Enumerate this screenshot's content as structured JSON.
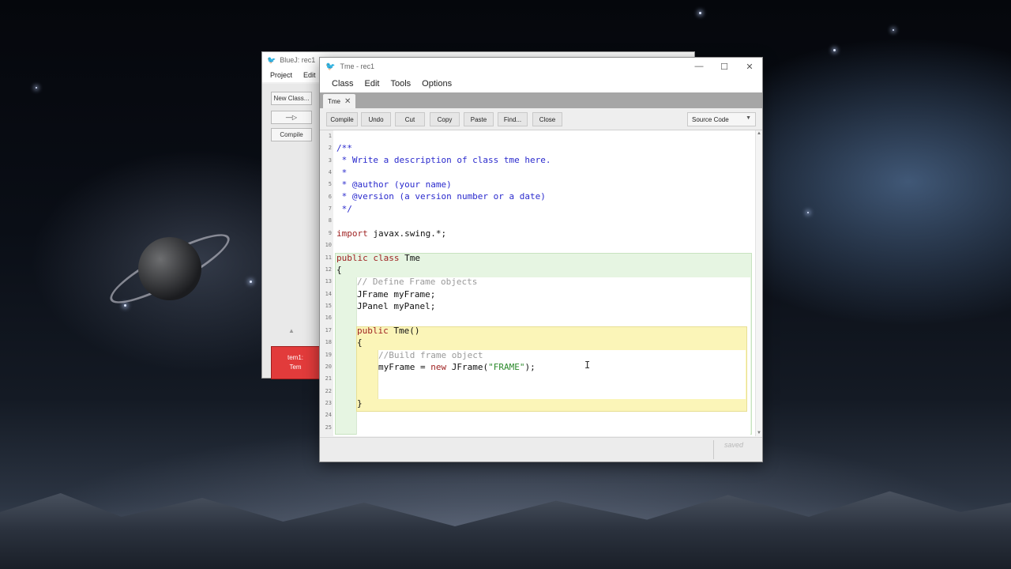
{
  "bluej_window": {
    "title": "BlueJ: rec1",
    "menu": [
      "Project",
      "Edit"
    ],
    "buttons": {
      "new_class": "New Class...",
      "arrow": "—▷",
      "compile": "Compile"
    },
    "class_box": {
      "line1": "tem1:",
      "line2": "Tem"
    }
  },
  "editor": {
    "title": "Tme - rec1",
    "window_controls": {
      "minimize": "—",
      "maximize": "☐",
      "close": "✕"
    },
    "menu": [
      "Class",
      "Edit",
      "Tools",
      "Options"
    ],
    "tab": {
      "label": "Tme",
      "close": "✕"
    },
    "toolbar": [
      "Compile",
      "Undo",
      "Cut",
      "Copy",
      "Paste",
      "Find...",
      "Close"
    ],
    "view_select": "Source Code",
    "line_numbers": [
      "1",
      "2",
      "3",
      "4",
      "5",
      "6",
      "7",
      "8",
      "9",
      "10",
      "11",
      "12",
      "13",
      "14",
      "15",
      "16",
      "17",
      "18",
      "19",
      "20",
      "21",
      "22",
      "23",
      "24",
      "25"
    ],
    "code": {
      "l2": "/**",
      "l3": " * Write a description of class tme here.",
      "l4": " *",
      "l5": " * @author (your name)",
      "l6": " * @version (a version number or a date)",
      "l7": " */",
      "l9_kw": "import",
      "l9_rest": " javax.swing.*;",
      "l11_kw1": "public",
      "l11_kw2": "class",
      "l11_rest": " Tme",
      "l12": "{",
      "l13": "// Define Frame objects",
      "l14": "JFrame myFrame;",
      "l15": "JPanel myPanel;",
      "l17_kw": "public",
      "l17_rest": " Tme()",
      "l18": "{",
      "l19": "//Build frame object",
      "l20_a": "myFrame = ",
      "l20_kw": "new",
      "l20_b": " JFrame(",
      "l20_str": "\"FRAME\"",
      "l20_c": ");",
      "l23": "}"
    },
    "status": "saved",
    "colors": {
      "class_scope": "#e6f5e2",
      "method_scope": "#fbf5b8",
      "keyword": "#9e1f1f",
      "comment": "#2a2acd",
      "string": "#2b8a2b"
    }
  }
}
